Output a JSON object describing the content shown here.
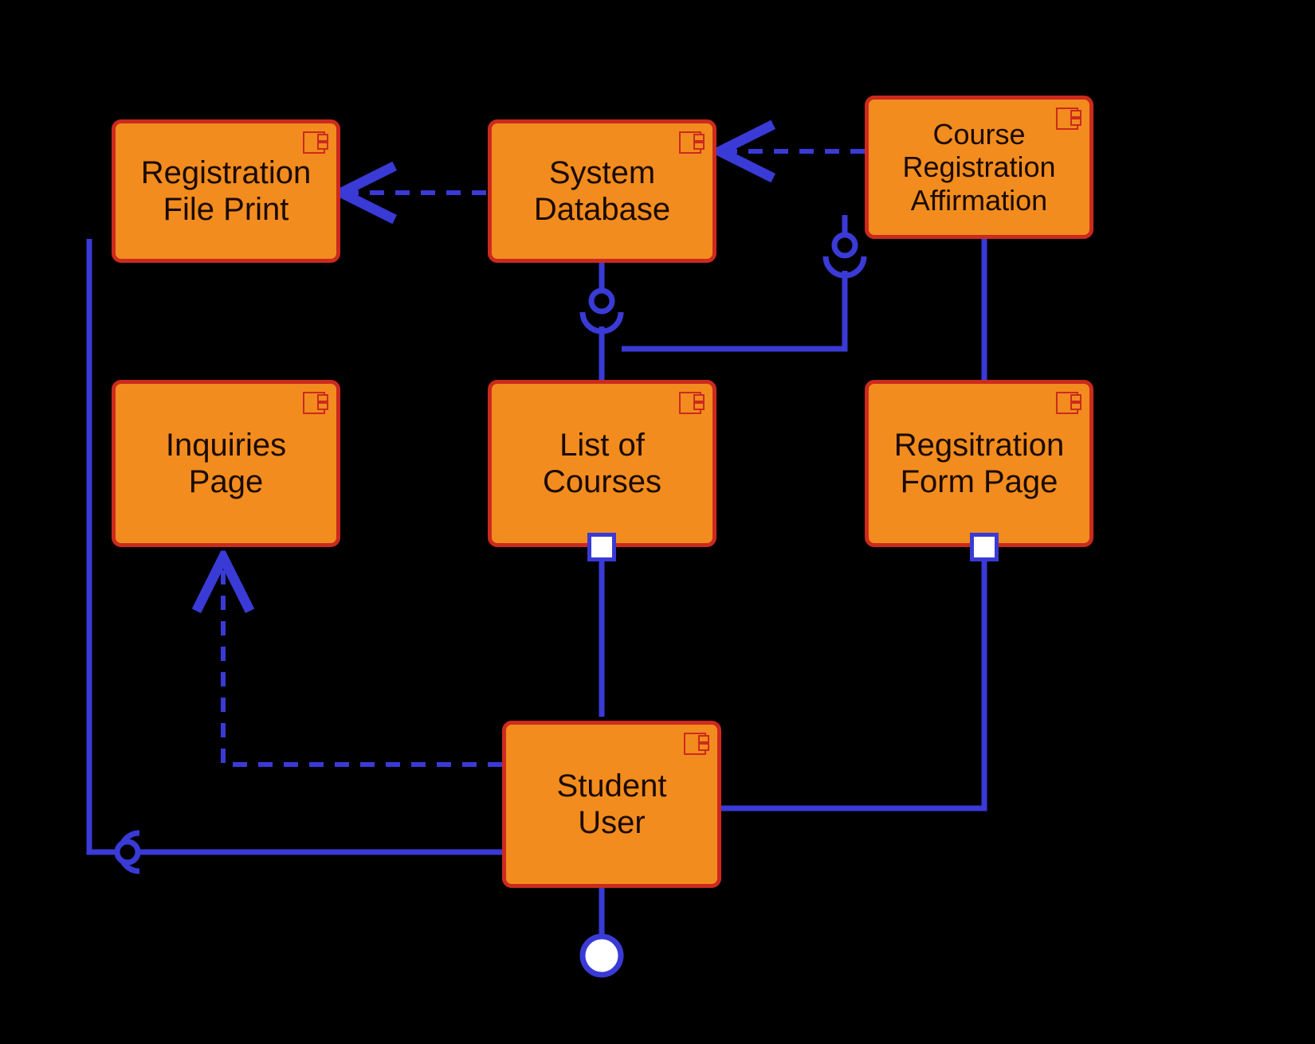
{
  "components": {
    "registrationFilePrint": {
      "label": "Registration\nFile Print"
    },
    "systemDatabase": {
      "label": "System\nDatabase"
    },
    "courseRegAffirm": {
      "label": "Course\nRegistration\nAffirmation"
    },
    "inquiriesPage": {
      "label": "Inquiries\nPage"
    },
    "listOfCourses": {
      "label": "List of\nCourses"
    },
    "registrationFormPage": {
      "label": "Regsitration\nForm Page"
    },
    "studentUser": {
      "label": "Student\nUser"
    }
  },
  "styles": {
    "fill": "#F28C1E",
    "border": "#CC2A1E",
    "connector": "#3A3AD6",
    "portFill": "#FFFFFF",
    "background": "#000000"
  },
  "connectors": [
    {
      "from": "systemDatabase",
      "to": "registrationFilePrint",
      "style": "dashed-arrow"
    },
    {
      "from": "courseRegAffirm",
      "to": "systemDatabase",
      "style": "dashed-arrow"
    },
    {
      "from": "studentUser",
      "to": "inquiriesPage",
      "style": "dashed-arrow"
    },
    {
      "from": "listOfCourses",
      "to": "systemDatabase",
      "style": "required-interface"
    },
    {
      "from": "registrationFormPage",
      "to": "courseRegAffirm",
      "style": "required-interface-via-courses-top"
    },
    {
      "from": "courseRegAffirm",
      "to": "registrationFormPage",
      "style": "solid"
    },
    {
      "from": "studentUser",
      "to": "listOfCourses",
      "style": "solid-port"
    },
    {
      "from": "studentUser",
      "to": "registrationFormPage",
      "style": "solid-port"
    },
    {
      "from": "studentUser",
      "to": "registrationFilePrint",
      "style": "required-interface-left-loop"
    },
    {
      "from": "studentUser",
      "to": null,
      "style": "provided-interface-bottom"
    }
  ]
}
